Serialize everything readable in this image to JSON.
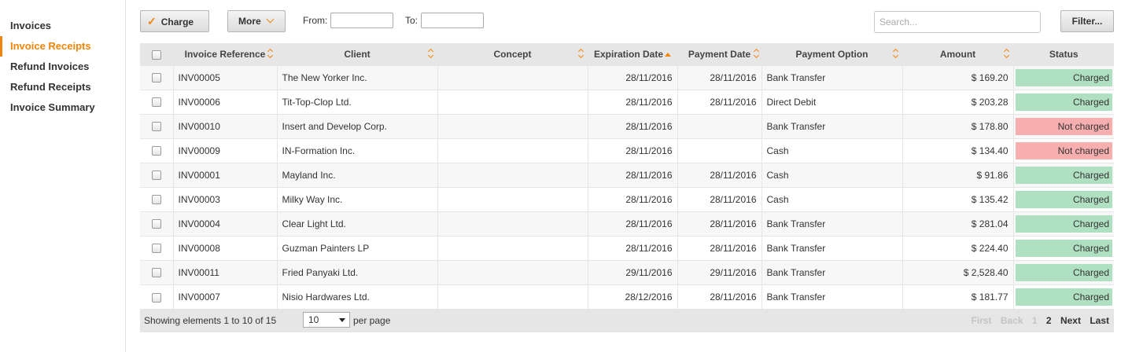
{
  "sidebar": {
    "items": [
      {
        "label": "Invoices"
      },
      {
        "label": "Invoice Receipts"
      },
      {
        "label": "Refund Invoices"
      },
      {
        "label": "Refund Receipts"
      },
      {
        "label": "Invoice Summary"
      }
    ],
    "active_index": 1
  },
  "toolbar": {
    "charge_label": "Charge",
    "more_label": "More",
    "from_label": "From:",
    "from_value": "",
    "to_label": "To:",
    "to_value": "",
    "search_placeholder": "Search...",
    "filter_label": "Filter..."
  },
  "table": {
    "columns": [
      "Invoice Reference",
      "Client",
      "Concept",
      "Expiration Date",
      "Payment Date",
      "Payment Option",
      "Amount",
      "Status"
    ],
    "sorted_column": "Expiration Date",
    "rows": [
      {
        "ref": "INV00005",
        "client": "The New Yorker Inc.",
        "concept": "",
        "expiration": "28/11/2016",
        "payment_date": "28/11/2016",
        "option": "Bank Transfer",
        "amount": "$ 169.20",
        "status": "Charged"
      },
      {
        "ref": "INV00006",
        "client": "Tit-Top-Clop Ltd.",
        "concept": "",
        "expiration": "28/11/2016",
        "payment_date": "28/11/2016",
        "option": "Direct Debit",
        "amount": "$ 203.28",
        "status": "Charged"
      },
      {
        "ref": "INV00010",
        "client": "Insert and Develop Corp.",
        "concept": "",
        "expiration": "28/11/2016",
        "payment_date": "",
        "option": "Bank Transfer",
        "amount": "$ 178.80",
        "status": "Not charged"
      },
      {
        "ref": "INV00009",
        "client": "IN-Formation Inc.",
        "concept": "",
        "expiration": "28/11/2016",
        "payment_date": "",
        "option": "Cash",
        "amount": "$ 134.40",
        "status": "Not charged"
      },
      {
        "ref": "INV00001",
        "client": "Mayland Inc.",
        "concept": "",
        "expiration": "28/11/2016",
        "payment_date": "28/11/2016",
        "option": "Cash",
        "amount": "$ 91.86",
        "status": "Charged"
      },
      {
        "ref": "INV00003",
        "client": "Milky Way Inc.",
        "concept": "",
        "expiration": "28/11/2016",
        "payment_date": "28/11/2016",
        "option": "Cash",
        "amount": "$ 135.42",
        "status": "Charged"
      },
      {
        "ref": "INV00004",
        "client": "Clear Light Ltd.",
        "concept": "",
        "expiration": "28/11/2016",
        "payment_date": "28/11/2016",
        "option": "Bank Transfer",
        "amount": "$ 281.04",
        "status": "Charged"
      },
      {
        "ref": "INV00008",
        "client": "Guzman Painters LP",
        "concept": "",
        "expiration": "28/11/2016",
        "payment_date": "28/11/2016",
        "option": "Bank Transfer",
        "amount": "$ 224.40",
        "status": "Charged"
      },
      {
        "ref": "INV00011",
        "client": "Fried Panyaki Ltd.",
        "concept": "",
        "expiration": "29/11/2016",
        "payment_date": "29/11/2016",
        "option": "Bank Transfer",
        "amount": "$ 2,528.40",
        "status": "Charged"
      },
      {
        "ref": "INV00007",
        "client": "Nisio Hardwares Ltd.",
        "concept": "",
        "expiration": "28/12/2016",
        "payment_date": "28/11/2016",
        "option": "Bank Transfer",
        "amount": "$ 181.77",
        "status": "Charged"
      }
    ]
  },
  "footer": {
    "info": "Showing elements 1 to 10 of 15",
    "per_page_value": "10",
    "per_page_label": "per page",
    "pager": {
      "first": "First",
      "back": "Back",
      "page1": "1",
      "page2": "2",
      "next": "Next",
      "last": "Last"
    }
  },
  "colors": {
    "accent": "#f0850a",
    "charged": "#b0e0c2",
    "not_charged": "#f6aeae"
  }
}
